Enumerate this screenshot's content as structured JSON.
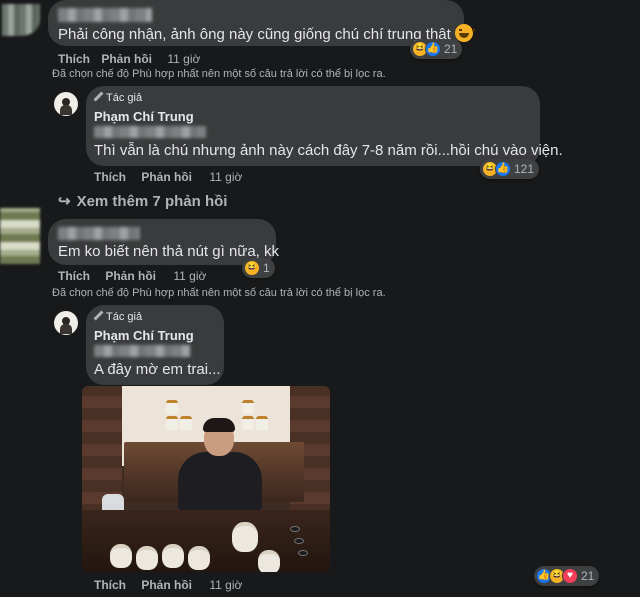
{
  "comments": [
    {
      "text": "Phải công nhận, ảnh ông này cũng giống chú chí trung thật",
      "actions": {
        "like": "Thích",
        "reply": "Phản hồi",
        "time": "11 giờ"
      },
      "reaction_count": "21",
      "reaction_icons": [
        "haha-icon",
        "like-icon"
      ],
      "filter_note": "Đã chọn chế độ Phù hợp nhất nên một số câu trả lời có thể bị lọc ra.",
      "reply": {
        "badge": "Tác giả",
        "author": "Phạm Chí Trung",
        "text": "Thì vẫn là chú nhưng ảnh này cách đây 7-8 năm rồi...hồi chú vào viện.",
        "actions": {
          "like": "Thích",
          "reply": "Phản hồi",
          "time": "11 giờ"
        },
        "reaction_count": "121",
        "reaction_icons": [
          "haha-icon",
          "like-icon"
        ]
      },
      "more_replies": "Xem thêm 7 phản hồi"
    },
    {
      "text": "Em ko biết nên thả nút gì nữa, kk",
      "actions": {
        "like": "Thích",
        "reply": "Phản hồi",
        "time": "11 giờ"
      },
      "reaction_count": "1",
      "reaction_icons": [
        "haha-icon"
      ],
      "filter_note": "Đã chọn chế độ Phù hợp nhất nên một số câu trả lời có thể bị lọc ra.",
      "reply": {
        "badge": "Tác giả",
        "author": "Phạm Chí Trung",
        "text": "A đây mờ em trai...",
        "actions": {
          "like": "Thích",
          "reply": "Phản hồi",
          "time": "11 giờ"
        },
        "reaction_count": "21",
        "reaction_icons": [
          "like-icon",
          "haha-icon",
          "love-icon"
        ]
      }
    }
  ],
  "colors": {
    "background": "#18191a",
    "bubble": "#3a3b3c",
    "text_primary": "#e4e6eb",
    "text_secondary": "#b0b3b8",
    "like_blue": "#1877f2",
    "haha_yellow": "#f7b125",
    "love_red": "#f33e58"
  }
}
